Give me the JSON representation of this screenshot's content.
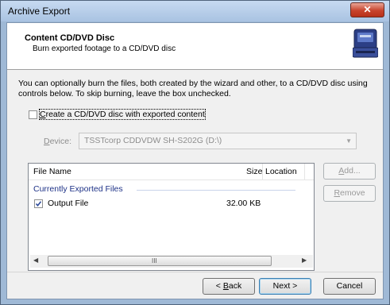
{
  "window": {
    "title": "Archive Export",
    "close_glyph": "✕"
  },
  "header": {
    "title": "Content CD/DVD Disc",
    "subtitle": "Burn exported footage to a CD/DVD disc",
    "icon": "disc-burner-icon"
  },
  "description": "You can optionally burn the files, both created by the wizard and other, to a CD/DVD disc using controls below. To skip burning, leave the box unchecked.",
  "burn_checkbox": {
    "label_mnemonic": "C",
    "label_rest": "reate a CD/DVD disc with exported content",
    "checked": false
  },
  "device": {
    "label_mnemonic": "D",
    "label_rest": "evice:",
    "value": "TSSTcorp CDDVDW SH-S202G  (D:\\)"
  },
  "file_list": {
    "columns": [
      "File Name",
      "Size",
      "Location"
    ],
    "group_label": "Currently Exported Files",
    "rows": [
      {
        "name": "Output File",
        "size": "32.00 KB",
        "checked": true
      }
    ],
    "scroll_grip": "III"
  },
  "side_buttons": {
    "add_mnemonic": "A",
    "add_rest": "dd...",
    "remove_mnemonic": "R",
    "remove_rest": "emove"
  },
  "nav_buttons": {
    "back_prefix": "< ",
    "back_mnemonic": "B",
    "back_rest": "ack",
    "next": "Next >",
    "cancel": "Cancel"
  },
  "colors": {
    "accent": "#1e3287",
    "window_frame": "#9fb9d6",
    "close": "#c7432c"
  }
}
